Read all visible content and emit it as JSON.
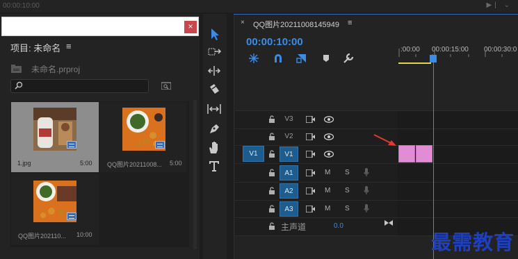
{
  "top": {
    "timecode": "00:00:10:00"
  },
  "project": {
    "title": "项目: 未命名",
    "menu": "≡",
    "file": "未命名.prproj",
    "close": "×",
    "items": [
      {
        "label": "1.jpg",
        "dur": "5:00"
      },
      {
        "label": "QQ图片20211008...",
        "dur": "5:00"
      },
      {
        "label": "QQ图片202110...",
        "dur": "10:00"
      }
    ]
  },
  "sequence": {
    "close": "×",
    "title": "QQ图片20211008145949",
    "menu": "≡",
    "timecode": "00:00:10:00",
    "ruler": [
      ":00:00",
      "00:00:15:00",
      "00:00:30:0"
    ],
    "source_patch": "V1",
    "video_tracks": [
      "V3",
      "V2",
      "V1"
    ],
    "audio_tracks": [
      "A1",
      "A2",
      "A3"
    ],
    "m_label": "M",
    "s_label": "S",
    "master_label": "主声道",
    "master_value": "0.0"
  },
  "watermark": "最需教育",
  "colors": {
    "accent": "#3b8ce6",
    "clip": "#e28cd6",
    "track_on": "#1d5c8e",
    "close_red": "#c8464c",
    "watermark": "#1e3fbf"
  }
}
